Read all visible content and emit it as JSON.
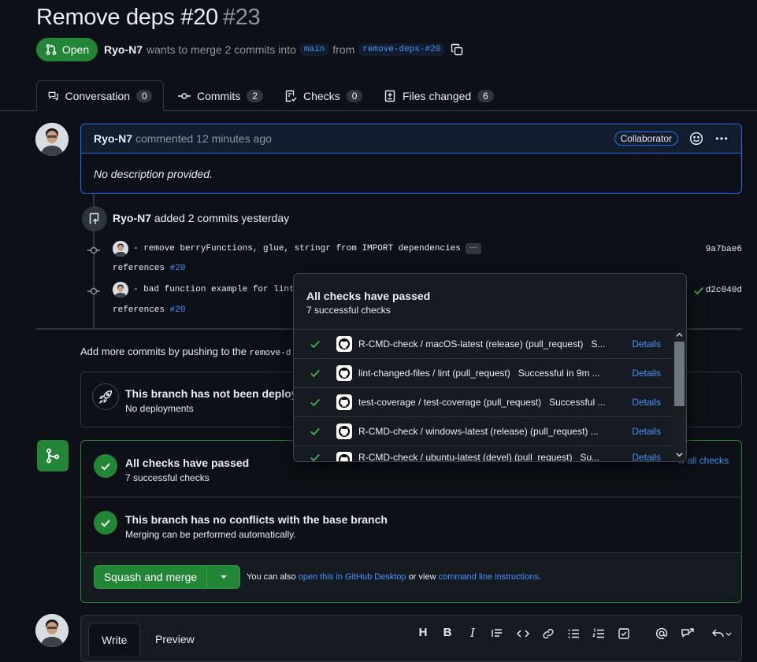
{
  "pr": {
    "title": "Remove deps #20",
    "number": "#23",
    "state": "Open",
    "author": "Ryo-N7",
    "merge_text": "wants to merge 2 commits into",
    "base": "main",
    "from": "from",
    "head": "remove-deps-#20"
  },
  "tabs": [
    {
      "label": "Conversation",
      "count": "0"
    },
    {
      "label": "Commits",
      "count": "2"
    },
    {
      "label": "Checks",
      "count": "0"
    },
    {
      "label": "Files changed",
      "count": "6"
    }
  ],
  "comment": {
    "author": "Ryo-N7",
    "action": "commented",
    "time": "12 minutes ago",
    "badge": "Collaborator",
    "body": "No description provided."
  },
  "commits_event": {
    "author": "Ryo-N7",
    "text": "added 2 commits yesterday"
  },
  "commits": [
    {
      "message": "- remove berryFunctions, glue, stringr from IMPORT dependencies",
      "refs": "references",
      "ref_link": "#20",
      "sha": "9a7bae6"
    },
    {
      "message": "- bad function example for lintr",
      "refs": "references",
      "ref_link": "#20",
      "sha": "d2c040d"
    }
  ],
  "push_hint": {
    "text": "Add more commits by pushing to the",
    "branch": "remove-d"
  },
  "deploy": {
    "title": "This branch has not been deployed",
    "subtitle": "No deployments"
  },
  "checks_summary": {
    "title": "All checks have passed",
    "subtitle": "7 successful checks",
    "link": "Show all checks",
    "link_visible": "w all checks"
  },
  "conflicts": {
    "title": "This branch has no conflicts with the base branch",
    "subtitle": "Merging can be performed automatically."
  },
  "merge": {
    "button": "Squash and merge",
    "also": "You can also",
    "desktop_link": "open this in GitHub Desktop",
    "or_view": "or view",
    "cli_link": "command line instructions",
    "period": "."
  },
  "popover": {
    "title": "All checks have passed",
    "subtitle": "7 successful checks",
    "checks": [
      {
        "name": "R-CMD-check / macOS-latest (release) (pull_request)",
        "status": "S...",
        "action": "Details"
      },
      {
        "name": "lint-changed-files / lint (pull_request)",
        "status": "Successful in 9m ...",
        "action": "Details"
      },
      {
        "name": "test-coverage / test-coverage (pull_request)",
        "status": "Successful ...",
        "action": "Details"
      },
      {
        "name": "R-CMD-check / windows-latest (release) (pull_request) ...",
        "status": "",
        "action": "Details"
      },
      {
        "name": "R-CMD-check / ubuntu-latest (devel) (pull_request)",
        "status": "Su...",
        "action": "Details"
      }
    ]
  },
  "editor": {
    "write": "Write",
    "preview": "Preview"
  },
  "colors": {
    "green": "#238636",
    "blue": "#4493f8",
    "bg": "#0d1117",
    "border": "#30363d"
  }
}
